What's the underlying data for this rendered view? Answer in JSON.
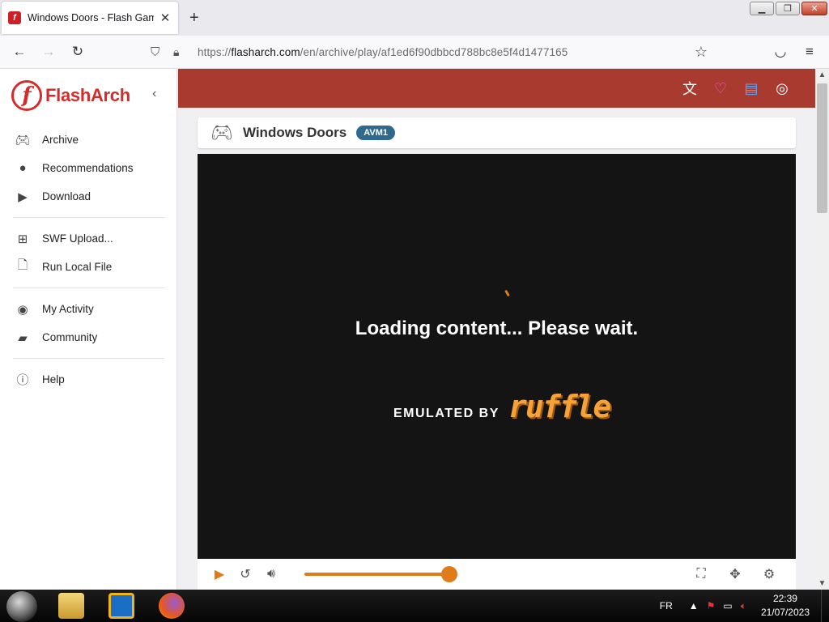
{
  "browser": {
    "tab_title": "Windows Doors - Flash Games",
    "tab_favicon_letter": "f",
    "url_prefix": "https://",
    "url_host": "flasharch.com",
    "url_path": "/en/archive/play/af1ed6f90dbbcd788bc8e5f4d1477165"
  },
  "sidebar": {
    "brand": "FlashArch",
    "brand_mark": "f",
    "items": [
      {
        "label": "Archive",
        "icon": "gamepad-icon"
      },
      {
        "label": "Recommendations",
        "icon": "flame-icon"
      },
      {
        "label": "Download",
        "icon": "download-icon"
      },
      {
        "label": "SWF Upload...",
        "icon": "plus-box-icon"
      },
      {
        "label": "Run Local File",
        "icon": "file-icon"
      },
      {
        "label": "My Activity",
        "icon": "person-icon"
      },
      {
        "label": "Community",
        "icon": "chat-icon"
      },
      {
        "label": "Help",
        "icon": "help-icon"
      }
    ]
  },
  "topbar": {
    "icons": [
      "translate-icon",
      "heart-icon",
      "feedback-icon",
      "account-icon"
    ],
    "heart_color": "#ff5ad0",
    "feedback_color": "#6aa0e8"
  },
  "game": {
    "title": "Windows Doors",
    "badge": "AVM1"
  },
  "player": {
    "loading_text": "Loading content... Please wait.",
    "emulated_by": "EMULATED BY",
    "ruffle_logo": "ruffle",
    "accent_color": "#e07b1a"
  },
  "taskbar": {
    "lang": "FR",
    "time": "22:39",
    "date": "21/07/2023"
  }
}
